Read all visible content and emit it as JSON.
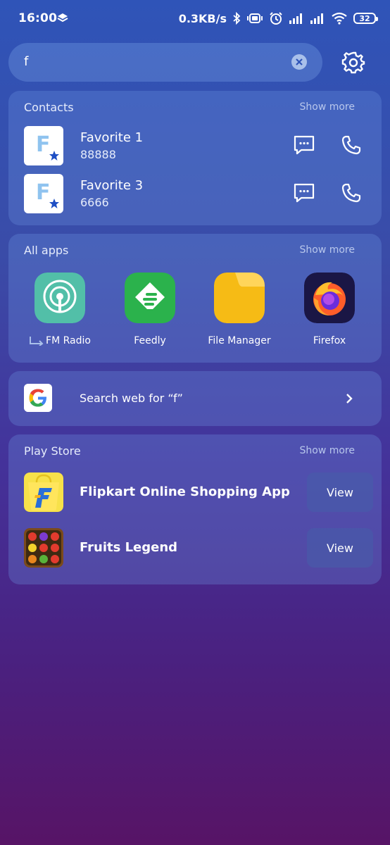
{
  "status_bar": {
    "time": "16:00",
    "network_speed": "0.3KB/s",
    "battery_level": "32"
  },
  "search": {
    "query": "f"
  },
  "contacts": {
    "title": "Contacts",
    "show_more": "Show more",
    "items": [
      {
        "initial": "F",
        "name": "Favorite 1",
        "number": "88888"
      },
      {
        "initial": "F",
        "name": "Favorite 3",
        "number": "6666"
      }
    ]
  },
  "apps": {
    "title": "All apps",
    "show_more": "Show more",
    "items": [
      {
        "label": "FM Radio",
        "icon": "radio-icon"
      },
      {
        "label": "Feedly",
        "icon": "feedly-icon"
      },
      {
        "label": "File Manager",
        "icon": "folder-icon"
      },
      {
        "label": "Firefox",
        "icon": "firefox-icon"
      }
    ]
  },
  "web_search": {
    "label": "Search web for “f”"
  },
  "play_store": {
    "title": "Play Store",
    "show_more": "Show more",
    "items": [
      {
        "name": "Flipkart Online Shopping App",
        "action": "View"
      },
      {
        "name": "Fruits Legend",
        "action": "View"
      }
    ]
  },
  "colors": {
    "accent_blue": "#2f54b8",
    "deep_purple": "#571466",
    "fm_radio": "#52bfa8",
    "feedly": "#2bb24c",
    "file_manager": "#f6bb15"
  }
}
